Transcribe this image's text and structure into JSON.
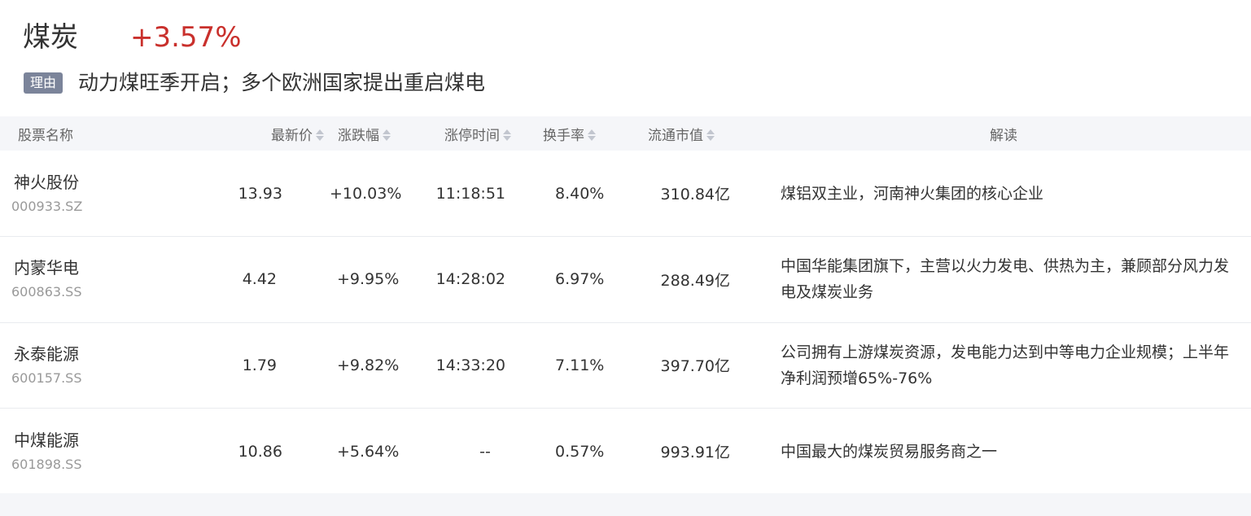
{
  "sector": {
    "name": "煤炭",
    "change": "+3.57%",
    "reason_label": "理由",
    "reason_text": "动力煤旺季开启；多个欧洲国家提出重启煤电"
  },
  "columns": {
    "name": "股票名称",
    "price": "最新价",
    "change": "涨跌幅",
    "limit_time": "涨停时间",
    "turnover": "换手率",
    "market_cap": "流通市值",
    "analysis": "解读"
  },
  "rows": [
    {
      "name": "神火股份",
      "code": "000933.SZ",
      "price": "13.93",
      "change": "+10.03%",
      "limit_time": "11:18:51",
      "turnover": "8.40%",
      "market_cap": "310.84亿",
      "analysis": "煤铝双主业，河南神火集团的核心企业"
    },
    {
      "name": "内蒙华电",
      "code": "600863.SS",
      "price": "4.42",
      "change": "+9.95%",
      "limit_time": "14:28:02",
      "turnover": "6.97%",
      "market_cap": "288.49亿",
      "analysis": "中国华能集团旗下，主营以火力发电、供热为主，兼顾部分风力发电及煤炭业务"
    },
    {
      "name": "永泰能源",
      "code": "600157.SS",
      "price": "1.79",
      "change": "+9.82%",
      "limit_time": "14:33:20",
      "turnover": "7.11%",
      "market_cap": "397.70亿",
      "analysis": "公司拥有上游煤炭资源，发电能力达到中等电力企业规模；上半年净利润预增65%-76%"
    },
    {
      "name": "中煤能源",
      "code": "601898.SS",
      "price": "10.86",
      "change": "+5.64%",
      "limit_time": "--",
      "turnover": "0.57%",
      "market_cap": "993.91亿",
      "analysis": "中国最大的煤炭贸易服务商之一"
    }
  ],
  "colors": {
    "up": "#c9302c",
    "tag_bg": "#7b849a",
    "header_bg": "#f5f6f9"
  },
  "icons": {
    "sort": "sort-icon"
  }
}
